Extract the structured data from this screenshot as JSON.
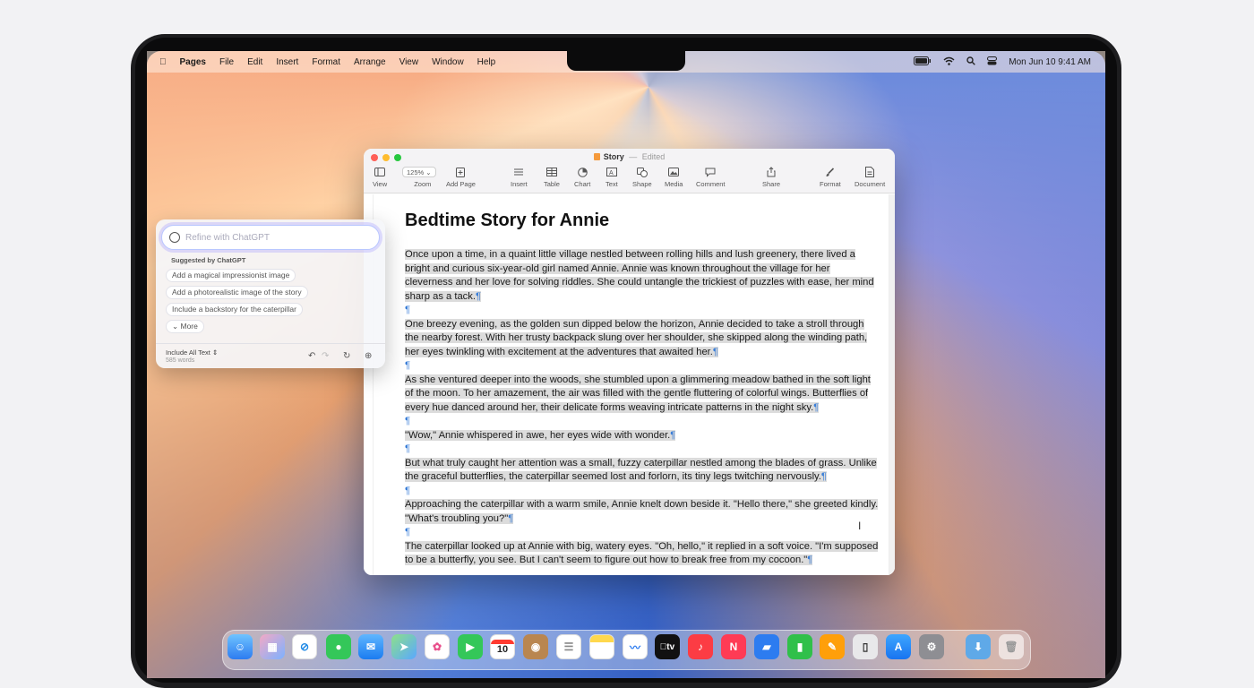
{
  "menubar": {
    "app": "Pages",
    "items": [
      "File",
      "Edit",
      "Insert",
      "Format",
      "Arrange",
      "View",
      "Window",
      "Help"
    ],
    "clock": "Mon Jun 10  9:41 AM"
  },
  "window": {
    "title": "Story",
    "status": "Edited",
    "toolbar": {
      "view": "View",
      "zoom_value": "125%",
      "zoom": "Zoom",
      "add_page": "Add Page",
      "insert": "Insert",
      "table": "Table",
      "chart": "Chart",
      "text": "Text",
      "shape": "Shape",
      "media": "Media",
      "comment": "Comment",
      "share": "Share",
      "format": "Format",
      "document": "Document"
    }
  },
  "document": {
    "heading": "Bedtime Story for Annie",
    "paragraphs": [
      "Once upon a time, in a quaint little village nestled between rolling hills and lush greenery, there lived a bright and curious six-year-old girl named Annie. Annie was known throughout the village for her cleverness and her love for solving riddles. She could untangle the trickiest of puzzles with ease, her mind sharp as a tack.",
      "One breezy evening, as the golden sun dipped below the horizon, Annie decided to take a stroll through the nearby forest. With her trusty backpack slung over her shoulder, she skipped along the winding path, her eyes twinkling with excitement at the adventures that awaited her.",
      "As she ventured deeper into the woods, she stumbled upon a glimmering meadow bathed in the soft light of the moon. To her amazement, the air was filled with the gentle fluttering of colorful wings. Butterflies of every hue danced around her, their delicate forms weaving intricate patterns in the night sky.",
      "\"Wow,\" Annie whispered in awe, her eyes wide with wonder.",
      "But what truly caught her attention was a small, fuzzy caterpillar nestled among the blades of grass. Unlike the graceful butterflies, the caterpillar seemed lost and forlorn, its tiny legs twitching nervously.",
      "Approaching the caterpillar with a warm smile, Annie knelt down beside it. \"Hello there,\" she greeted kindly. \"What's troubling you?\"",
      "The caterpillar looked up at Annie with big, watery eyes. \"Oh, hello,\" it replied in a soft voice. \"I'm supposed to be a butterfly, you see. But I can't seem to figure out how to break free from my cocoon.\""
    ],
    "pilcrow": "¶"
  },
  "refine_panel": {
    "placeholder": "Refine with ChatGPT",
    "suggested_label": "Suggested by ChatGPT",
    "suggestions": [
      "Add a magical impressionist image",
      "Add a photorealistic image of the story",
      "Include a backstory for the caterpillar"
    ],
    "more": "More",
    "include": "Include All Text",
    "word_count": "585 words"
  },
  "dock": {
    "calendar_day": "10",
    "tv_label": "tv"
  },
  "colors": {
    "close": "#ff5f57",
    "minimize": "#febc2e",
    "zoom": "#28c840",
    "pilcrow": "#3b7fd8",
    "selection": "#dcdcdc"
  }
}
